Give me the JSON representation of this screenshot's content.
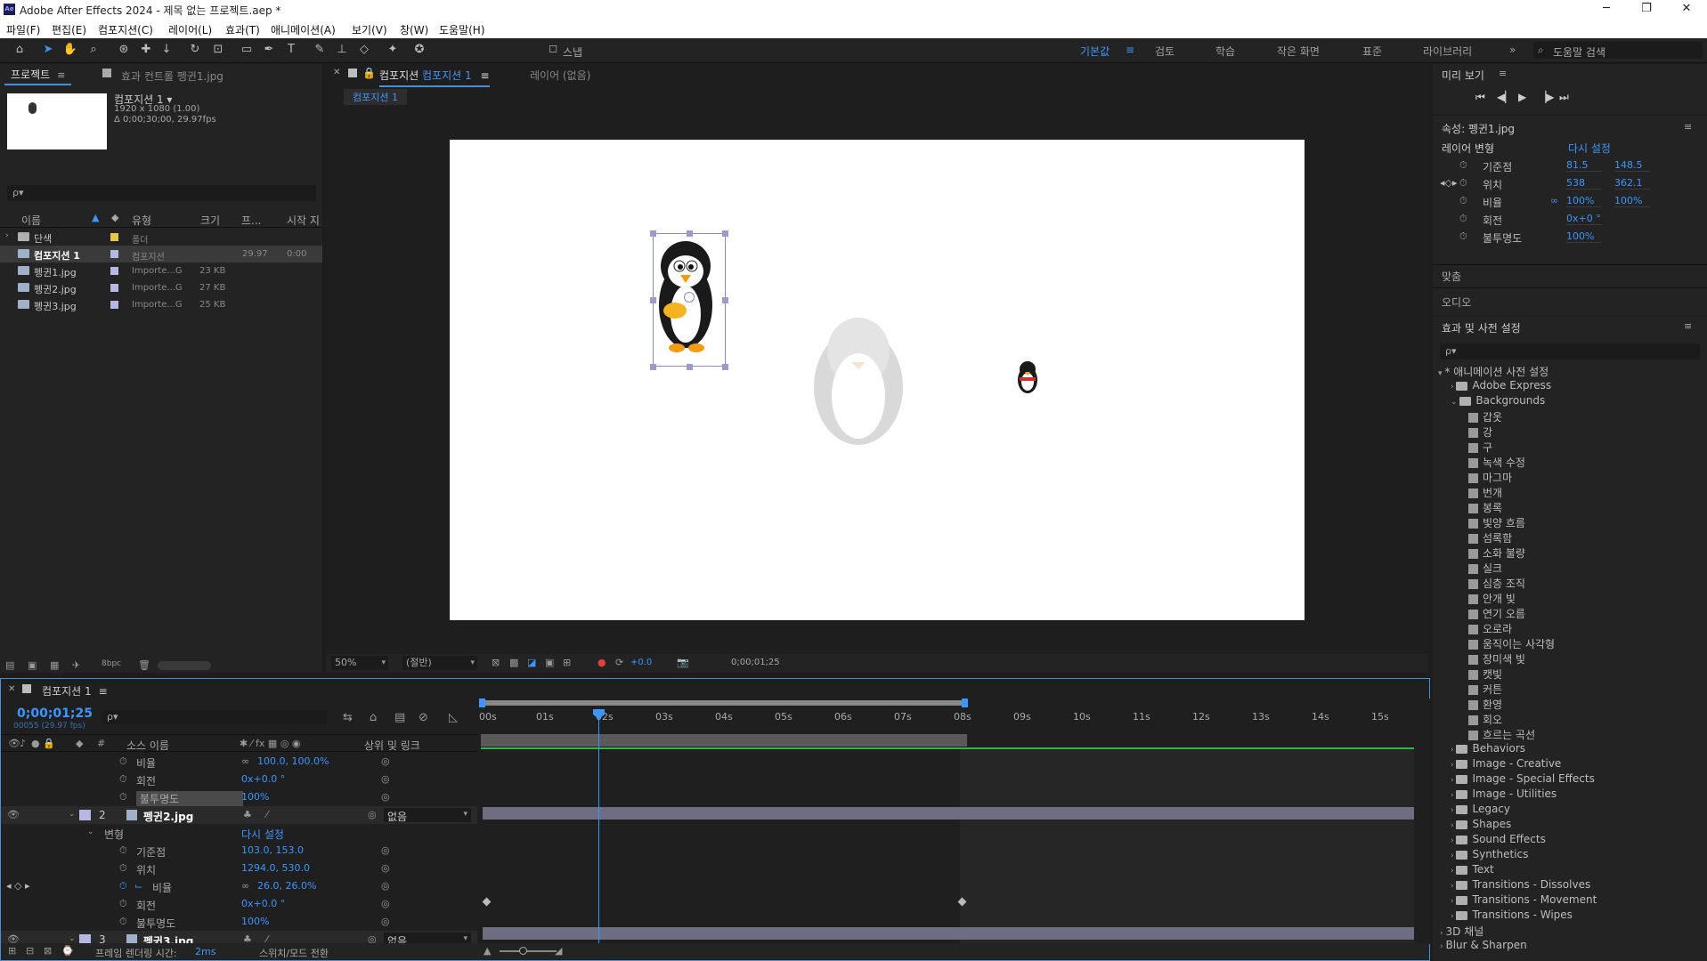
{
  "window": {
    "title": "Adobe After Effects 2024 - 제목 없는 프로젝트.aep *",
    "app_badge": "Ae",
    "controls": {
      "minimize": "─",
      "maximize": "❐",
      "close": "✕"
    }
  },
  "menu": [
    "파일(F)",
    "편집(E)",
    "컴포지션(C)",
    "레이어(L)",
    "효과(T)",
    "애니메이션(A)",
    "보기(V)",
    "창(W)",
    "도움말(H)"
  ],
  "toolbar": {
    "snap_label": "스냅",
    "workspaces": [
      "기본값",
      "검토",
      "학습",
      "작은 화면",
      "표준",
      "라이브러리"
    ],
    "active_workspace": "기본값",
    "more": "»",
    "search_placeholder": "도움말 검색"
  },
  "project_panel": {
    "tab_label": "프로젝트",
    "effects_tab": "효과 컨트롤 펭귄1.jpg",
    "comp_name": "컴포지션 1 ▾",
    "comp_size": "1920 x 1080 (1.00)",
    "comp_duration": "Δ 0;00;30;00, 29.97fps",
    "search_placeholder": "ρ▾",
    "columns": [
      "이름",
      "유형",
      "크기",
      "프...",
      "시작 지"
    ],
    "items": [
      {
        "name": "단색",
        "type": "폴더",
        "size": "",
        "fps": "",
        "start": "",
        "label_color": "#e6c64a",
        "kind": "folder"
      },
      {
        "name": "컴포지션 1",
        "type": "컴포지션",
        "size": "",
        "fps": "29.97",
        "start": "0:00",
        "label_color": "#b7b7e6",
        "kind": "comp"
      },
      {
        "name": "펭귄1.jpg",
        "type": "Importe...G",
        "size": "23 KB",
        "fps": "",
        "start": "",
        "label_color": "#b7b7e6",
        "kind": "file"
      },
      {
        "name": "펭귄2.jpg",
        "type": "Importe...G",
        "size": "27 KB",
        "fps": "",
        "start": "",
        "label_color": "#b7b7e6",
        "kind": "file"
      },
      {
        "name": "펭귄3.jpg",
        "type": "Importe...G",
        "size": "25 KB",
        "fps": "",
        "start": "",
        "label_color": "#b7b7e6",
        "kind": "file"
      }
    ],
    "bpc": "8bpc"
  },
  "viewer": {
    "tab_label": "컴포지션",
    "tab_comp": "컴포지션 1",
    "layer_tab": "레이어 (없음)",
    "breadcrumb": "컴포지션 1",
    "zoom": "50%",
    "resolution": "(절반)",
    "exposure": "+0.0",
    "timecode": "0;00;01;25"
  },
  "timeline": {
    "tab_label": "컴포지션 1",
    "timecode": "0;00;01;25",
    "frame_info": "00055 (29.97 fps)",
    "search_placeholder": "ρ▾",
    "col_source": "소스 이름",
    "col_parent": "상위 및 링크",
    "ruler": [
      "00s",
      "01s",
      "02s",
      "03s",
      "04s",
      "05s",
      "06s",
      "07s",
      "08s",
      "09s",
      "10s",
      "11s",
      "12s",
      "13s",
      "14s",
      "15s"
    ],
    "rows": [
      {
        "label": "비율",
        "value": "100.0, 100.0%",
        "type": "prop"
      },
      {
        "label": "회전",
        "value": "0x+0.0 °",
        "type": "prop"
      },
      {
        "label": "불투명도",
        "value": "100%",
        "type": "prop",
        "selected": true
      },
      {
        "num": "2",
        "name": "펭귄2.jpg",
        "parent": "없음",
        "type": "layer"
      },
      {
        "label": "변형",
        "value": "다시 설정",
        "type": "group"
      },
      {
        "label": "기준점",
        "value": "103.0, 153.0",
        "type": "prop"
      },
      {
        "label": "위치",
        "value": "1294.0, 530.0",
        "type": "prop"
      },
      {
        "label": "비율",
        "value": "26.0, 26.0%",
        "type": "prop",
        "keyed": true
      },
      {
        "label": "회전",
        "value": "0x+0.0 °",
        "type": "prop"
      },
      {
        "label": "불투명도",
        "value": "100%",
        "type": "prop"
      },
      {
        "num": "3",
        "name": "펭귄3.jpg",
        "parent": "없음",
        "type": "layer"
      }
    ],
    "footer_render": "프레임 렌더링 시간:",
    "footer_render_value": "2ms",
    "footer_switch": "스위치/모드 전환"
  },
  "preview_panel": {
    "title": "미리 보기"
  },
  "properties_panel": {
    "title": "속성: 펭귄1.jpg",
    "section": "레이어 변형",
    "reset": "다시 설정",
    "props": [
      {
        "label": "기준점",
        "v1": "81.5",
        "v2": "148.5"
      },
      {
        "label": "위치",
        "v1": "538",
        "v2": "362.1"
      },
      {
        "label": "비율",
        "v1": "100%",
        "v2": "100%"
      },
      {
        "label": "회전",
        "v1": "0x+0 °",
        "v2": ""
      },
      {
        "label": "불투명도",
        "v1": "100%",
        "v2": ""
      }
    ],
    "align": "맞춤",
    "audio": "오디오"
  },
  "effects_panel": {
    "title": "효과 및 사전 설정",
    "search_placeholder": "ρ▾",
    "root": "* 애니메이션 사전 설정",
    "items": [
      {
        "label": "Adobe Express",
        "type": "folder",
        "depth": 1,
        "open": false
      },
      {
        "label": "Backgrounds",
        "type": "folder",
        "depth": 1,
        "open": true
      },
      {
        "label": "갑옷",
        "type": "preset",
        "depth": 2
      },
      {
        "label": "강",
        "type": "preset",
        "depth": 2
      },
      {
        "label": "구",
        "type": "preset",
        "depth": 2
      },
      {
        "label": "녹색 수정",
        "type": "preset",
        "depth": 2
      },
      {
        "label": "마그마",
        "type": "preset",
        "depth": 2
      },
      {
        "label": "번개",
        "type": "preset",
        "depth": 2
      },
      {
        "label": "봉록",
        "type": "preset",
        "depth": 2
      },
      {
        "label": "빛양 흐름",
        "type": "preset",
        "depth": 2
      },
      {
        "label": "섬록함",
        "type": "preset",
        "depth": 2
      },
      {
        "label": "소화 불량",
        "type": "preset",
        "depth": 2
      },
      {
        "label": "실크",
        "type": "preset",
        "depth": 2
      },
      {
        "label": "심층 조직",
        "type": "preset",
        "depth": 2
      },
      {
        "label": "안개 빛",
        "type": "preset",
        "depth": 2
      },
      {
        "label": "연기 오름",
        "type": "preset",
        "depth": 2
      },
      {
        "label": "오로라",
        "type": "preset",
        "depth": 2
      },
      {
        "label": "움직이는 사각형",
        "type": "preset",
        "depth": 2
      },
      {
        "label": "장미색 빛",
        "type": "preset",
        "depth": 2
      },
      {
        "label": "캣빛",
        "type": "preset",
        "depth": 2
      },
      {
        "label": "커튼",
        "type": "preset",
        "depth": 2
      },
      {
        "label": "환영",
        "type": "preset",
        "depth": 2
      },
      {
        "label": "회오",
        "type": "preset",
        "depth": 2
      },
      {
        "label": "흐르는 곡선",
        "type": "preset",
        "depth": 2
      },
      {
        "label": "Behaviors",
        "type": "folder",
        "depth": 1
      },
      {
        "label": "Image - Creative",
        "type": "folder",
        "depth": 1
      },
      {
        "label": "Image - Special Effects",
        "type": "folder",
        "depth": 1
      },
      {
        "label": "Image - Utilities",
        "type": "folder",
        "depth": 1
      },
      {
        "label": "Legacy",
        "type": "folder",
        "depth": 1
      },
      {
        "label": "Shapes",
        "type": "folder",
        "depth": 1
      },
      {
        "label": "Sound Effects",
        "type": "folder",
        "depth": 1
      },
      {
        "label": "Synthetics",
        "type": "folder",
        "depth": 1
      },
      {
        "label": "Text",
        "type": "folder",
        "depth": 1
      },
      {
        "label": "Transitions - Dissolves",
        "type": "folder",
        "depth": 1
      },
      {
        "label": "Transitions - Movement",
        "type": "folder",
        "depth": 1
      },
      {
        "label": "Transitions - Wipes",
        "type": "folder",
        "depth": 1
      },
      {
        "label": "3D 채널",
        "type": "cat",
        "depth": 0
      },
      {
        "label": "Blur & Sharpen",
        "type": "cat",
        "depth": 0
      }
    ]
  },
  "colors": {
    "accent": "#3d95ff",
    "bg": "#1d1d1d",
    "panel": "#232323",
    "selection": "#4a8dd8",
    "work_area_green": "#2fb844"
  }
}
